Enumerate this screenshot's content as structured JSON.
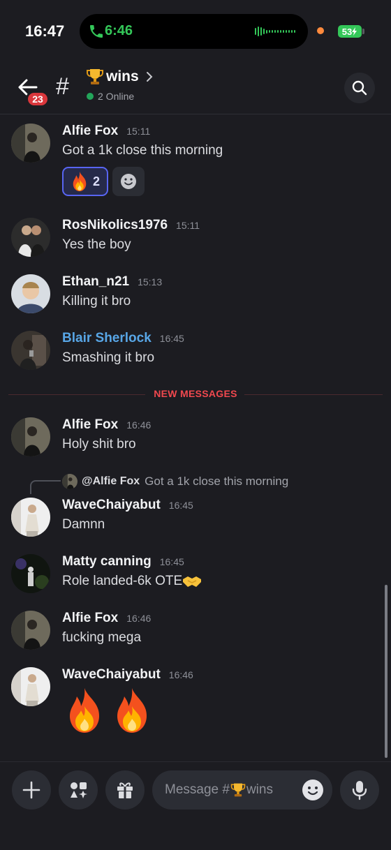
{
  "status_bar": {
    "time": "16:47",
    "call_timer": "6:46",
    "battery": "53"
  },
  "header": {
    "unread_count": "23",
    "hash": "#",
    "channel_name": "wins",
    "channel_emoji": "trophy-icon",
    "online_text": "2 Online"
  },
  "messages": [
    {
      "author": "Alfie Fox",
      "time": "15:11",
      "text": "Got a 1k close this morning",
      "reaction": {
        "emoji": "fire",
        "count": "2"
      }
    },
    {
      "author": "RosNikolics1976",
      "time": "15:11",
      "text": "Yes the boy"
    },
    {
      "author": "Ethan_n21",
      "time": "15:13",
      "text": "Killing it bro"
    },
    {
      "author": "Blair Sherlock",
      "time": "16:45",
      "text": "Smashing it bro"
    },
    {
      "author": "Alfie Fox",
      "time": "16:46",
      "text": "Holy shit bro"
    },
    {
      "author": "WaveChaiyabut",
      "time": "16:45",
      "text": "Damnn",
      "reply_to": {
        "author": "@Alfie Fox",
        "text": "Got a 1k close this morning"
      }
    },
    {
      "author": "Matty canning",
      "time": "16:45",
      "text": "Role landed-6k OTE"
    },
    {
      "author": "Alfie Fox",
      "time": "16:46",
      "text": "fucking mega"
    },
    {
      "author": "WaveChaiyabut",
      "time": "16:46",
      "emoji_only": [
        "fire",
        "fire"
      ]
    }
  ],
  "new_messages_divider": "NEW MESSAGES",
  "composer": {
    "placeholder_prefix": "Message #",
    "placeholder_channel": "wins"
  },
  "colors": {
    "background": "#1c1c21",
    "accent": "#5865f2",
    "online": "#23a55a",
    "new_messages": "#f0484e",
    "highlight_author": "#58a6e6"
  }
}
